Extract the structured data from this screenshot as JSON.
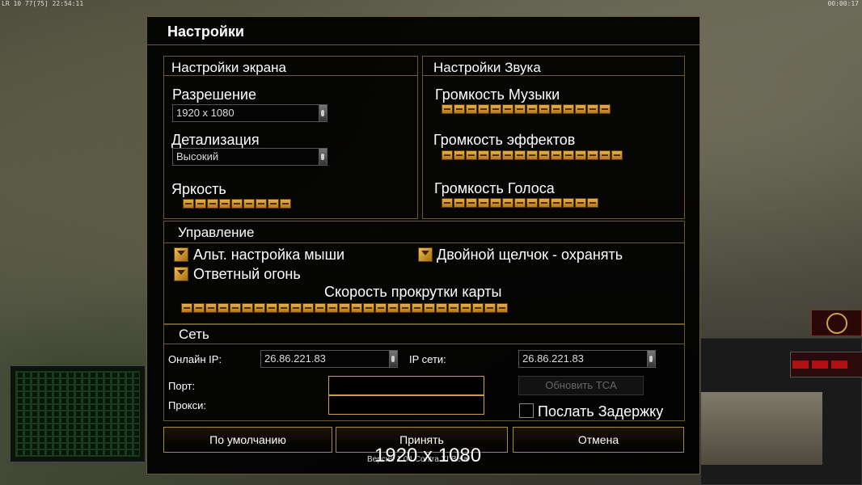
{
  "hud": {
    "left": "LR 10 77[75] 22:54:11",
    "right": "00:00:17"
  },
  "dialog": {
    "title": "Настройки",
    "screen": {
      "title": "Настройки экрана",
      "resolution_label": "Разрешение",
      "resolution_value": "1920 x 1080",
      "detail_label": "Детализация",
      "detail_value": "Высокий",
      "brightness_label": "Яркость"
    },
    "sound": {
      "title": "Настройки Звука",
      "music_label": "Громкость Музыки",
      "effects_label": "Громкость эффектов",
      "voice_label": "Громкость Голоса"
    },
    "control": {
      "title": "Управление",
      "alt_mouse_label": "Альт. настройка мыши",
      "double_click_label": "Двойной щелчок - охранять",
      "return_fire_label": "Ответный огонь",
      "scroll_speed_label": "Скорость прокрутки карты"
    },
    "network": {
      "title": "Сеть",
      "online_ip_label": "Онлайн IP:",
      "online_ip_value": "26.86.221.83",
      "lan_ip_label": "IP сети:",
      "lan_ip_value": "26.86.221.83",
      "port_label": "Порт:",
      "proxy_label": "Прокси:",
      "update_tca_label": "Обновить TCA",
      "send_delay_label": "Послать Задержку"
    },
    "buttons": {
      "default_label": "По умолчанию",
      "accept_label": "Принять",
      "cancel_label": "Отмена"
    }
  },
  "overlay_resolution": "1920 x 1080",
  "version_text": "Версия 1.04 Contra XI Beta",
  "sliders": {
    "brightness": {
      "segments": 9
    },
    "music": {
      "segments": 14
    },
    "effects": {
      "segments": 15
    },
    "voice": {
      "segments": 13
    },
    "scroll_speed": {
      "segments": 27
    }
  },
  "checkboxes": {
    "alt_mouse": true,
    "double_click": true,
    "return_fire": true,
    "send_delay": false
  },
  "colors": {
    "border": "#6a5a2c",
    "accent": "#c9a050",
    "slider": "#e8b040"
  }
}
